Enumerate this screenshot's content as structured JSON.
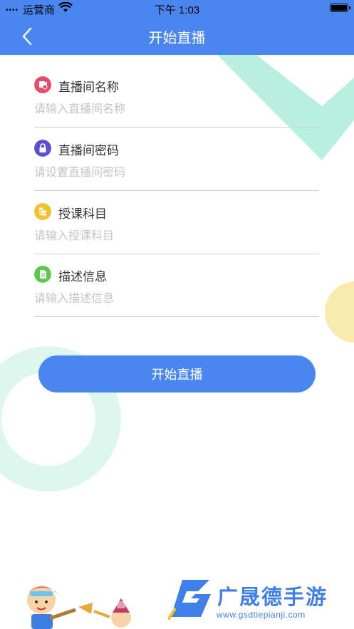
{
  "status_bar": {
    "signal": "••••",
    "carrier": "运营商",
    "time": "下午 1:03"
  },
  "nav": {
    "title": "开始直播",
    "back_icon": "chevron-left-icon"
  },
  "form": {
    "fields": [
      {
        "label": "直播间名称",
        "placeholder": "请输入直播间名称",
        "value": "",
        "icon": "video-icon",
        "icon_color": "#E84A6A"
      },
      {
        "label": "直播间密码",
        "placeholder": "请设置直播间密码",
        "value": "",
        "icon": "lock-icon",
        "icon_color": "#5B4FD6"
      },
      {
        "label": "授课科目",
        "placeholder": "请输入授课科目",
        "value": "",
        "icon": "list-icon",
        "icon_color": "#F2C12E"
      },
      {
        "label": "描述信息",
        "placeholder": "请输入描述信息",
        "value": "",
        "icon": "document-icon",
        "icon_color": "#5CC94A"
      }
    ]
  },
  "button": {
    "label": "开始直播"
  },
  "watermark": {
    "title": "广晟德手游",
    "url": "www.gsdtiepianji.com"
  },
  "colors": {
    "primary": "#4A86F0",
    "mint": "#B8EFE0",
    "yellow": "#FBEAB0"
  }
}
